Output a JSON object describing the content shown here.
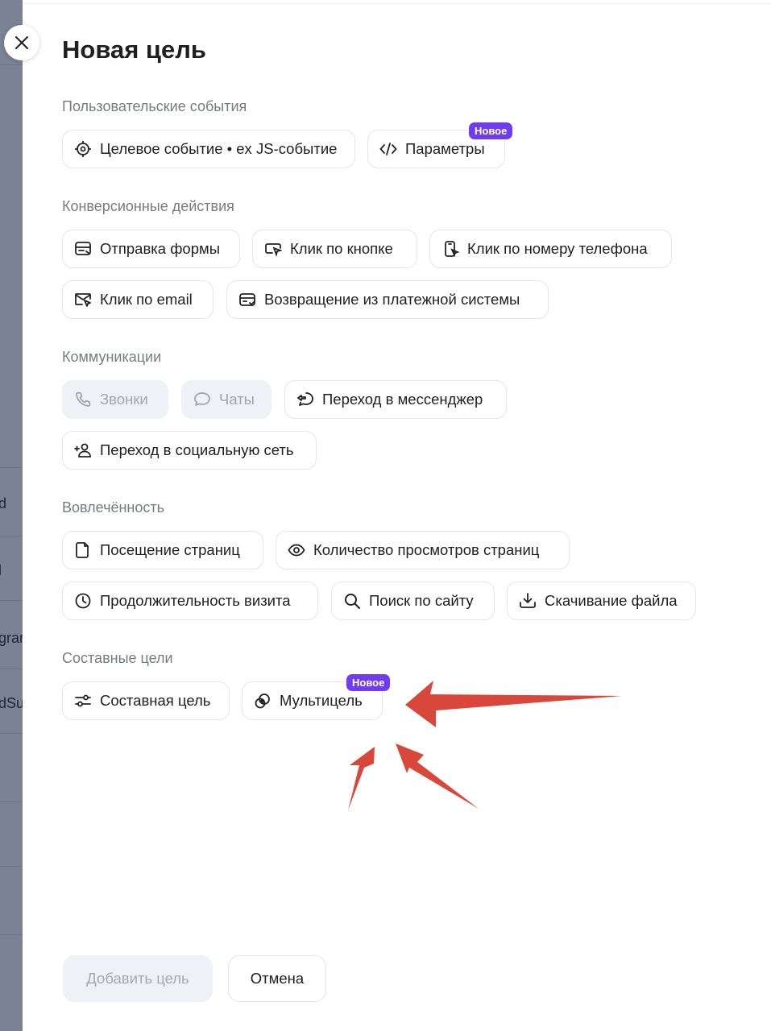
{
  "backdrop": {
    "fragments": [
      "d",
      "l",
      "grar",
      "dSu"
    ]
  },
  "dialog": {
    "title": "Новая цель",
    "close_icon": "close-icon",
    "sections": {
      "custom_events": {
        "title": "Пользовательские события",
        "items": [
          {
            "label": "Целевое событие • ex JS-событие",
            "icon": "target-icon"
          },
          {
            "label": "Параметры",
            "icon": "code-icon",
            "badge": "Новое"
          }
        ]
      },
      "conversion": {
        "title": "Конверсионные действия",
        "items": [
          {
            "label": "Отправка формы",
            "icon": "form-icon"
          },
          {
            "label": "Клик по кнопке",
            "icon": "button-click-icon"
          },
          {
            "label": "Клик по номеру телефона",
            "icon": "phone-click-icon"
          },
          {
            "label": "Клик по email",
            "icon": "email-click-icon"
          },
          {
            "label": "Возвращение из платежной системы",
            "icon": "payment-icon"
          }
        ]
      },
      "communications": {
        "title": "Коммуникации",
        "items": [
          {
            "label": "Звонки",
            "icon": "phone-icon",
            "disabled": true
          },
          {
            "label": "Чаты",
            "icon": "chat-icon",
            "disabled": true
          },
          {
            "label": "Переход в мессенджер",
            "icon": "messenger-icon"
          },
          {
            "label": "Переход в социальную сеть",
            "icon": "social-icon"
          }
        ]
      },
      "engagement": {
        "title": "Вовлечённость",
        "items": [
          {
            "label": "Посещение страниц",
            "icon": "page-icon"
          },
          {
            "label": "Количество просмотров страниц",
            "icon": "eye-icon"
          },
          {
            "label": "Продолжительность визита",
            "icon": "clock-icon"
          },
          {
            "label": "Поиск по сайту",
            "icon": "search-icon"
          },
          {
            "label": "Скачивание файла",
            "icon": "download-icon"
          }
        ]
      },
      "composite": {
        "title": "Составные цели",
        "items": [
          {
            "label": "Составная цель",
            "icon": "sliders-icon"
          },
          {
            "label": "Мультицель",
            "icon": "multigoal-icon",
            "badge": "Новое"
          }
        ]
      }
    },
    "footer": {
      "add_label": "Добавить цель",
      "cancel_label": "Отмена"
    }
  },
  "colors": {
    "badge": "#6f3cf0",
    "annotation_arrow": "#d9473b",
    "disabled_bg": "#eef1f5"
  }
}
